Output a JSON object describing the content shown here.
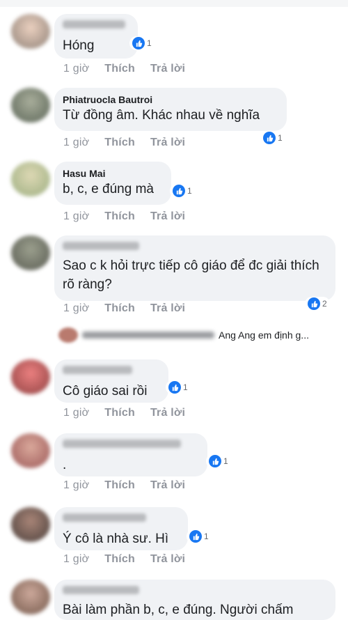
{
  "comments": [
    {
      "author": "",
      "text": "Hóng",
      "likes": "1",
      "time": "1 giờ",
      "like_label": "Thích",
      "reply_label": "Trả lời"
    },
    {
      "author": "Phiatruocla Bautroi",
      "text": "Từ đồng âm. Khác nhau về nghĩa",
      "likes": "1",
      "time": "1 giờ",
      "like_label": "Thích",
      "reply_label": "Trả lời"
    },
    {
      "author": "Hasu Mai",
      "text": "b, c, e đúng mà",
      "likes": "1",
      "time": "1 giờ",
      "like_label": "Thích",
      "reply_label": "Trả lời"
    },
    {
      "author": "",
      "text": "Sao c k hỏi trực tiếp cô giáo để đc giải thích rõ ràng?",
      "likes": "2",
      "time": "1 giờ",
      "like_label": "Thích",
      "reply_label": "Trả lời"
    },
    {
      "author": "",
      "text": "Cô giáo sai rồi",
      "likes": "1",
      "time": "1 giờ",
      "like_label": "Thích",
      "reply_label": "Trả lời"
    },
    {
      "author": "",
      "text": ".",
      "likes": "1",
      "time": "1 giờ",
      "like_label": "Thích",
      "reply_label": "Trả lời"
    },
    {
      "author": "",
      "text": "Ý cô là nhà sư. Hì",
      "likes": "1",
      "time": "1 giờ",
      "like_label": "Thích",
      "reply_label": "Trả lời"
    },
    {
      "author": "",
      "text": "Bài làm phần b, c, e đúng. Người chấm"
    }
  ],
  "reply_preview": {
    "text": "Ang Ang em định g..."
  },
  "colors": {
    "like_blue": "#1877f2",
    "bubble": "#f0f2f5",
    "meta": "#90949c"
  }
}
